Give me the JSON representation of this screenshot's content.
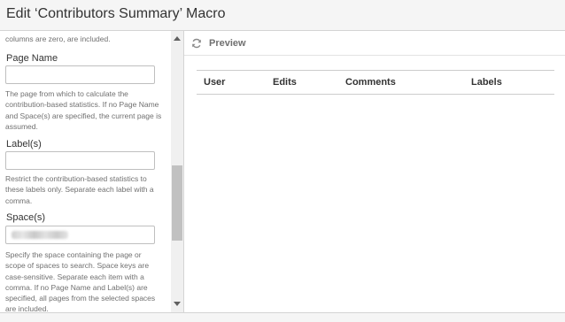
{
  "dialog": {
    "title": "Edit ‘Contributors Summary’ Macro"
  },
  "form": {
    "top_help": "columns are zero, are included.",
    "page_name": {
      "label": "Page Name",
      "value": "",
      "help": "The page from which to calculate the contribution-based statistics. If no Page Name and Space(s) are specified, the current page is assumed."
    },
    "labels": {
      "label": "Label(s)",
      "value": "",
      "help": "Restrict the contribution-based statistics to these labels only. Separate each label with a comma."
    },
    "spaces": {
      "label": "Space(s)",
      "value_obscured": true,
      "help": "Specify the space containing the page or scope of spaces to search. Space keys are case-sensitive. Separate each item with a comma. If no Page Name and Label(s) are specified, all pages from the selected spaces are included."
    }
  },
  "preview": {
    "label": "Preview",
    "icon": "refresh-icon",
    "table_headers": [
      "User",
      "Edits",
      "Comments",
      "Labels"
    ]
  },
  "colors": {
    "header_bg": "#f5f5f5",
    "border": "#d4d4d4",
    "help_text": "#707070",
    "scroll_thumb": "#c1c1c1"
  }
}
